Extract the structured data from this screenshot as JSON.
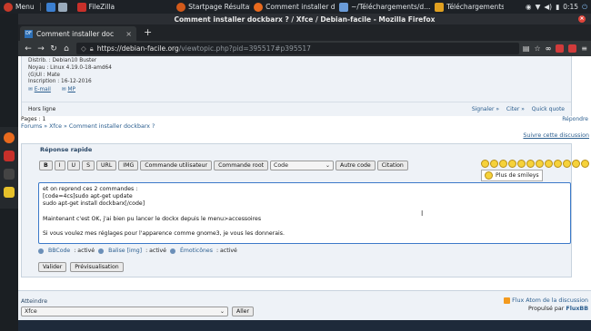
{
  "taskbar": {
    "items": [
      {
        "label": "Menu",
        "color": "#c83a2a"
      },
      {
        "label": "FileZilla",
        "color": "#c8302a"
      },
      {
        "label": "Startpage Résultats ...",
        "color": "#d35a1a"
      },
      {
        "label": "Comment installer d...",
        "color": "#e86a1e"
      },
      {
        "label": "~/Téléchargements/d...",
        "color": "#6a9bd8"
      },
      {
        "label": "Téléchargements",
        "color": "#e0a020"
      }
    ],
    "clock": "0:15"
  },
  "window": {
    "title": "Comment installer dockbarx ? / Xfce / Debian-facile - Mozilla Firefox",
    "tab_label": "Comment installer doc",
    "tab_favicon": "DF",
    "url_domain": "https://debian-facile.org",
    "url_path": "/viewtopic.php?pid=395517#p395517"
  },
  "post": {
    "info": [
      "Distrib. : Debian10 Buster",
      "Noyau : Linux 4.19.0-18-amd64",
      "(G)UI : Mate",
      "Inscription : 16-12-2016"
    ],
    "email": "E-mail",
    "mp": "MP",
    "status": "Hors ligne",
    "actions": [
      "Signaler",
      "Citer",
      "Quick quote"
    ]
  },
  "pages": {
    "label": "Pages :",
    "value": "1",
    "reply": "Répondre"
  },
  "breadcrumb": {
    "forums": "Forums",
    "cat": "Xfce",
    "topic": "Comment installer dockbarx ?",
    "subscribe": "Suivre cette discussion"
  },
  "quick_reply": {
    "title": "Réponse rapide",
    "buttons": [
      "B",
      "I",
      "U",
      "S",
      "URL",
      "IMG",
      "Commande utilisateur",
      "Commande root"
    ],
    "code_select": "Code",
    "other_buttons": [
      "Autre code",
      "Citation"
    ],
    "more_smileys": "Plus de smileys",
    "lines": [
      "et on reprend ces 2 commandes :",
      "[code=4cs]sudo apt-get update",
      "sudo apt-get install dockbarx[/code]",
      "",
      "Maintenant c'est OK, j'ai bien pu lancer le dockx depuis le menu>accessoires",
      "",
      "Si vous voulez mes réglages pour l'apparence comme gnome3, je vous les donnerais."
    ],
    "status": [
      {
        "link": "BBCode",
        "value": ": activé"
      },
      {
        "link": "Balise [img]",
        "value": ": activé"
      },
      {
        "link": "Émoticônes",
        "value": ": activé"
      }
    ],
    "submit": "Valider",
    "preview": "Prévisualisation"
  },
  "footer": {
    "jump_label": "Atteindre",
    "jump_value": "Xfce",
    "go": "Aller",
    "feed": "Flux Atom de la discussion",
    "powered_prefix": "Propulsé par",
    "powered": "FluxBB"
  },
  "colors": {
    "link": "#2a5d8e",
    "accent": "#3b79c9"
  }
}
